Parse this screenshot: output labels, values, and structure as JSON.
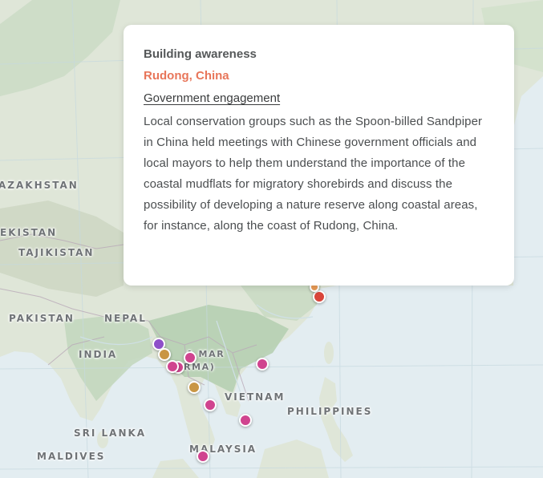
{
  "map": {
    "labels": {
      "kazakhstan": "AZAKHSTAN",
      "uzbekistan": "EKISTAN",
      "tajikistan": "TAJIKISTAN",
      "pakistan": "PAKISTAN",
      "nepal": "NEPAL",
      "india": "INDIA",
      "myanmar_1": "A MAR",
      "myanmar_2": "(B RMA)",
      "vietnam": "VIETNAM",
      "philippines": "PHILIPPINES",
      "sri_lanka": "SRI LANKA",
      "malaysia": "MALAYSIA",
      "maldives": "MALDIVES"
    },
    "colors": {
      "ocean": "#e3edf1",
      "land": "#dfe6d8",
      "vegetation": "#bcd3b8",
      "marker_magenta": "#d0448f",
      "marker_purple": "#8e4fc9",
      "marker_gold": "#c99644",
      "marker_red": "#d9453a",
      "marker_orange": "#e89a55"
    }
  },
  "popup": {
    "heading": "Building awareness",
    "location": "Rudong, China",
    "category": "Government engagement",
    "body": "Local conservation groups such as the Spoon-billed Sandpiper in China held meetings with Chinese government officials and local mayors to help them understand the importance of the coastal mudflats for migratory shorebirds and discuss the possibility of developing a nature reserve along coastal areas, for instance, along the coast of Rudong, China."
  }
}
